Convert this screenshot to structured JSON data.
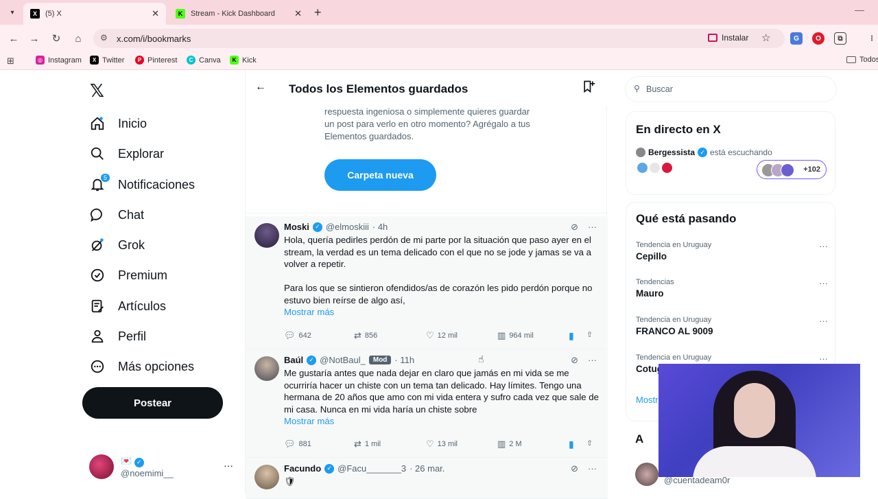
{
  "browser": {
    "tabs": [
      {
        "title": "(5) X",
        "active": true
      },
      {
        "title": "Stream - Kick Dashboard",
        "active": false
      }
    ],
    "url": "x.com/i/bookmarks",
    "install_label": "Instalar",
    "bookmarks": [
      "Instagram",
      "Twitter",
      "Pinterest",
      "Canva",
      "Kick"
    ],
    "bookmarks_folder": "Todos"
  },
  "nav": {
    "items": [
      {
        "label": "Inicio",
        "icon": "home-icon"
      },
      {
        "label": "Explorar",
        "icon": "search-icon"
      },
      {
        "label": "Notificaciones",
        "icon": "bell-icon",
        "badge": "5"
      },
      {
        "label": "Chat",
        "icon": "chat-icon"
      },
      {
        "label": "Grok",
        "icon": "grok-icon"
      },
      {
        "label": "Premium",
        "icon": "premium-icon"
      },
      {
        "label": "Artículos",
        "icon": "articles-icon"
      },
      {
        "label": "Perfil",
        "icon": "person-icon"
      },
      {
        "label": "Más opciones",
        "icon": "more-options-icon"
      }
    ],
    "post_button": "Postear",
    "profile": {
      "name": "💌",
      "handle": "@noemimi__"
    }
  },
  "main": {
    "title": "Todos los Elementos guardados",
    "empty_text": "respuesta ingeniosa o simplemente quieres guardar un post para verlo en otro momento? Agrégalo a tus Elementos guardados.",
    "new_folder_button": "Carpeta nueva",
    "tweets": [
      {
        "name": "Moski",
        "handle": "@elmoskiii",
        "time": "· 4h",
        "paragraphs": [
          "Hola, quería pedirles perdón de mi parte por la situación que paso ayer en el stream, la verdad es un tema delicado con el que no se jode y jamas se va a volver a repetir.",
          "Para los que se sintieron ofendidos/as de corazón les pido perdón porque no estuvo bien reírse de algo así,"
        ],
        "more": "Mostrar más",
        "replies": "642",
        "reposts": "856",
        "likes": "12 mil",
        "views": "964 mil"
      },
      {
        "name": "Baúl",
        "handle": "@NotBaul_",
        "badge": "Mod",
        "time": "· 11h",
        "paragraphs": [
          "Me gustaría antes que nada dejar en claro que jamás en mi vida se me ocurriría hacer un chiste con un tema tan delicado. Hay límites. Tengo una hermana de 20 años que amo con mi vida entera y sufro cada vez que sale de mi casa. Nunca en mi vida haría un chiste sobre"
        ],
        "more": "Mostrar más",
        "replies": "881",
        "reposts": "1 mil",
        "likes": "13 mil",
        "views": "2 M"
      },
      {
        "name": "Facundo",
        "handle": "@Facu_______3",
        "time": "· 26 mar."
      }
    ]
  },
  "right": {
    "search_placeholder": "Buscar",
    "live": {
      "title": "En directo en X",
      "user": "Bergessista",
      "status": "está escuchando",
      "listeners": "+102"
    },
    "trends": {
      "title": "Qué está pasando",
      "items": [
        {
          "context": "Tendencia en Uruguay",
          "name": "Cepillo"
        },
        {
          "context": "Tendencias",
          "name": "Mauro"
        },
        {
          "context": "Tendencia en Uruguay",
          "name": "FRANCO AL 9009"
        },
        {
          "context": "Tendencia en Uruguay",
          "name": "Cotug"
        }
      ],
      "show_more": "Mostr"
    },
    "follow_title": "A",
    "follow_handle": "@cuentadeam0r"
  },
  "colors": {
    "accent": "#1d9bf0",
    "tab_bar": "#f9d7de",
    "text": "#0f1419",
    "secondary": "#536471"
  }
}
